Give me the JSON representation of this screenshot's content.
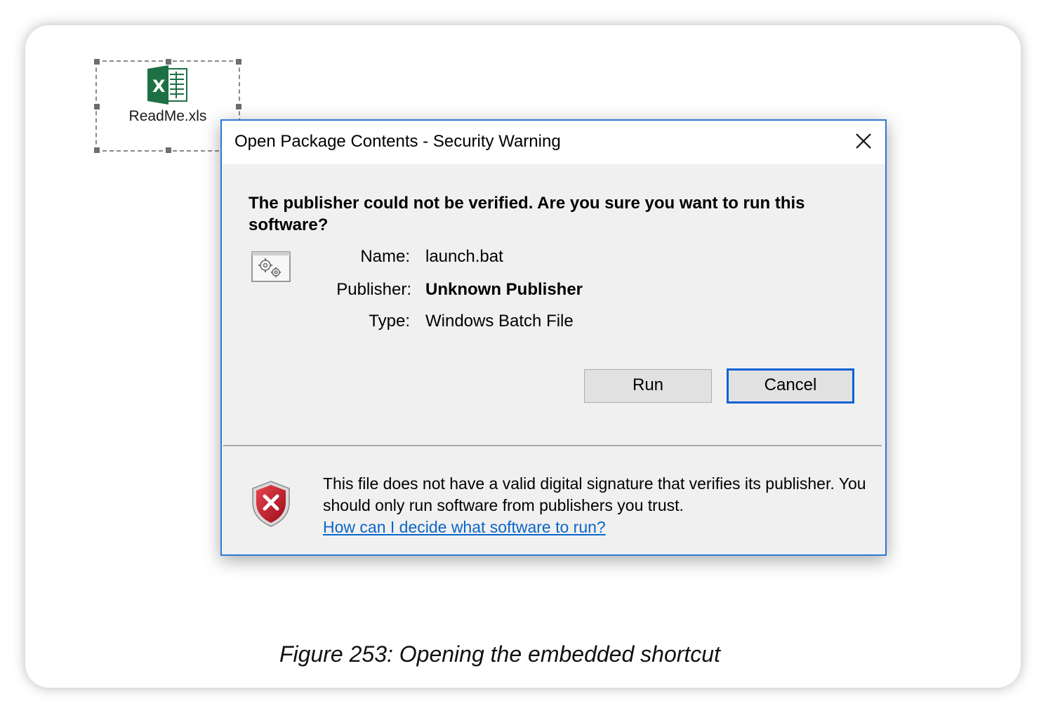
{
  "embedded_file": {
    "label": "ReadMe.xls",
    "icon": "excel-icon"
  },
  "dialog": {
    "title": "Open Package Contents - Security Warning",
    "close_icon": "close-icon",
    "headline": "The publisher could not be verified.  Are you sure you want to run this software?",
    "file_icon": "batch-file-icon",
    "fields": [
      {
        "label": "Name:",
        "value": "launch.bat",
        "bold": false
      },
      {
        "label": "Publisher:",
        "value": "Unknown Publisher",
        "bold": true
      },
      {
        "label": "Type:",
        "value": "Windows Batch File",
        "bold": false
      }
    ],
    "buttons": {
      "run": "Run",
      "cancel": "Cancel"
    },
    "warning": {
      "icon": "security-shield-error-icon",
      "text": "This file does not have a valid digital signature that verifies its publisher.  You should only run software from publishers you trust.",
      "link": "How can I decide what software to run?"
    }
  },
  "caption": "Figure 253: Opening the embedded shortcut",
  "colors": {
    "accent": "#2b79d8",
    "link": "#0a66c8",
    "excel_green": "#1d7044",
    "shield_red": "#c8102e"
  }
}
